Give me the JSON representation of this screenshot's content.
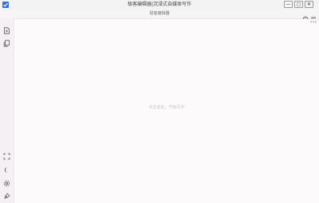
{
  "window": {
    "title": "极客编辑器|沉浸式自媒体写作",
    "minimize_label": "—",
    "maximize_label": "▢",
    "close_label": "✕"
  },
  "header": {
    "subtitle": "极客编辑器"
  },
  "editor": {
    "placeholder": "点击此处，开始写作"
  },
  "icons": {
    "app": "app-check-icon",
    "top_right": [
      "palette-icon",
      "menu-icon"
    ],
    "sidebar_top": [
      "new-file-icon",
      "copy-icon"
    ],
    "sidebar_bottom": [
      "fullscreen-icon",
      "dark-mode-icon",
      "settings-icon",
      "pin-icon"
    ],
    "more": "more-icon"
  },
  "colors": {
    "accent": "#2f6fe0",
    "background": "#f5f0f4",
    "editor_background": "#fdfafc"
  }
}
